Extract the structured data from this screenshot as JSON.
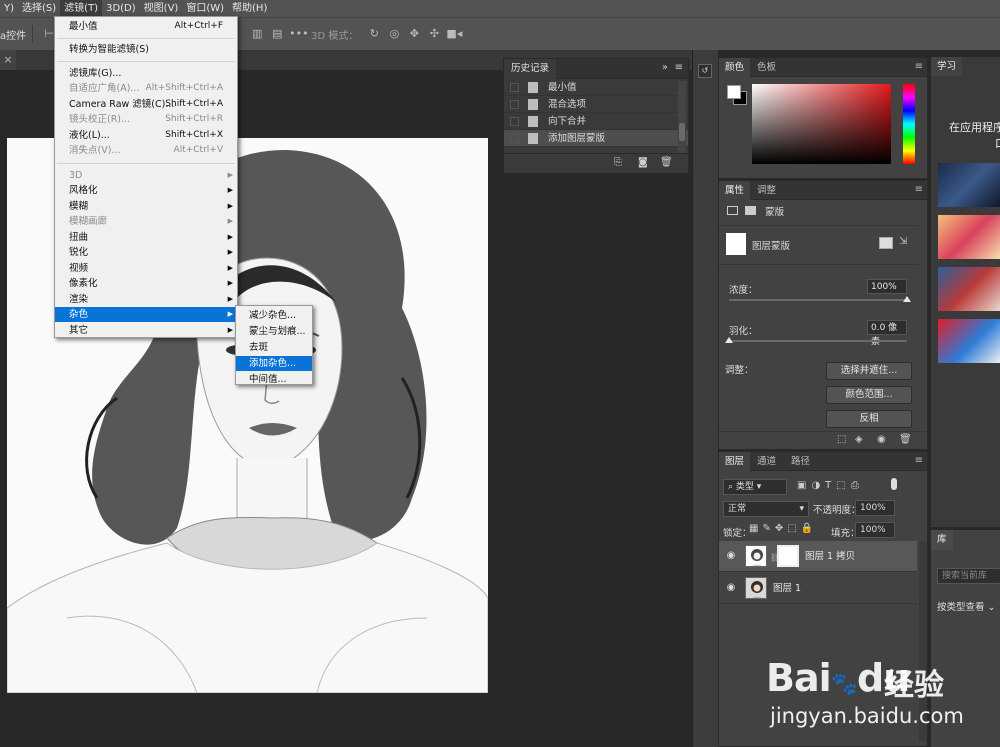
{
  "menubar": {
    "items": [
      "Y)",
      "选择(S)",
      "滤镜(T)",
      "3D(D)",
      "视图(V)",
      "窗口(W)",
      "帮助(H)"
    ],
    "active_index": 2
  },
  "optionsbar": {
    "left_label": "a控件",
    "mode_3d_label": "3D 模式："
  },
  "filter_menu": {
    "last_filter": {
      "label": "最小值",
      "shortcut": "Alt+Ctrl+F"
    },
    "convert_smart": {
      "label": "转换为智能滤镜(S)"
    },
    "gallery": {
      "label": "滤镜库(G)..."
    },
    "adaptive_wide": {
      "label": "自适应广角(A)...",
      "shortcut": "Alt+Shift+Ctrl+A"
    },
    "camera_raw": {
      "label": "Camera Raw 滤镜(C)...",
      "shortcut": "Shift+Ctrl+A"
    },
    "lens_correction": {
      "label": "镜头校正(R)...",
      "shortcut": "Shift+Ctrl+R"
    },
    "liquify": {
      "label": "液化(L)...",
      "shortcut": "Shift+Ctrl+X"
    },
    "vanishing_point": {
      "label": "消失点(V)...",
      "shortcut": "Alt+Ctrl+V"
    },
    "submenus": [
      "3D",
      "风格化",
      "模糊",
      "模糊画廊",
      "扭曲",
      "锐化",
      "视频",
      "像素化",
      "渲染",
      "杂色",
      "其它"
    ],
    "highlighted_submenu": "杂色"
  },
  "noise_submenu": {
    "items": [
      "减少杂色...",
      "蒙尘与划痕...",
      "去斑",
      "添加杂色...",
      "中间值..."
    ],
    "highlighted": "添加杂色..."
  },
  "history_panel": {
    "tab": "历史记录",
    "menu_glyph": "»",
    "rows": [
      "最小值",
      "混合选项",
      "向下合并",
      "添加图层蒙版"
    ],
    "selected_index": 3
  },
  "color_panel": {
    "tabs": [
      "颜色",
      "色板"
    ],
    "active_tab": "颜色",
    "foreground": "#ffffff",
    "background": "#000000",
    "hue": "#e4181b"
  },
  "properties_panel": {
    "tabs": [
      "属性",
      "调整"
    ],
    "active_tab": "属性",
    "subtype": "蒙版",
    "mask_label": "图层蒙版",
    "density_label": "浓度：",
    "density_value": "100%",
    "density_fraction": 1.0,
    "feather_label": "羽化：",
    "feather_value": "0.0 像素",
    "feather_fraction": 0.0,
    "adjust_label": "调整：",
    "buttons": [
      "选择并遮住...",
      "颜色范围...",
      "反相"
    ]
  },
  "layers_panel": {
    "tabs": [
      "图层",
      "通道",
      "路径"
    ],
    "active_tab": "图层",
    "filter_kind": "类型",
    "blend_mode": "正常",
    "opacity_label": "不透明度：",
    "opacity_value": "100%",
    "lock_label": "锁定：",
    "fill_label": "填充：",
    "fill_value": "100%",
    "layers": [
      {
        "name": "图层 1 拷贝",
        "selected": true,
        "has_mask": true
      },
      {
        "name": "图层 1",
        "selected": false,
        "has_mask": false
      }
    ]
  },
  "learn_panel": {
    "tab": "学习",
    "title_line1": "在应用程序",
    "title_line2": "口"
  },
  "library_panel": {
    "tab": "库",
    "search_placeholder": "搜索当前库",
    "view_by_type": "按类型查看"
  },
  "watermark": {
    "brand": "Bai",
    "paw": "du",
    "jingyan": "经验",
    "url": "jingyan.baidu.com"
  }
}
